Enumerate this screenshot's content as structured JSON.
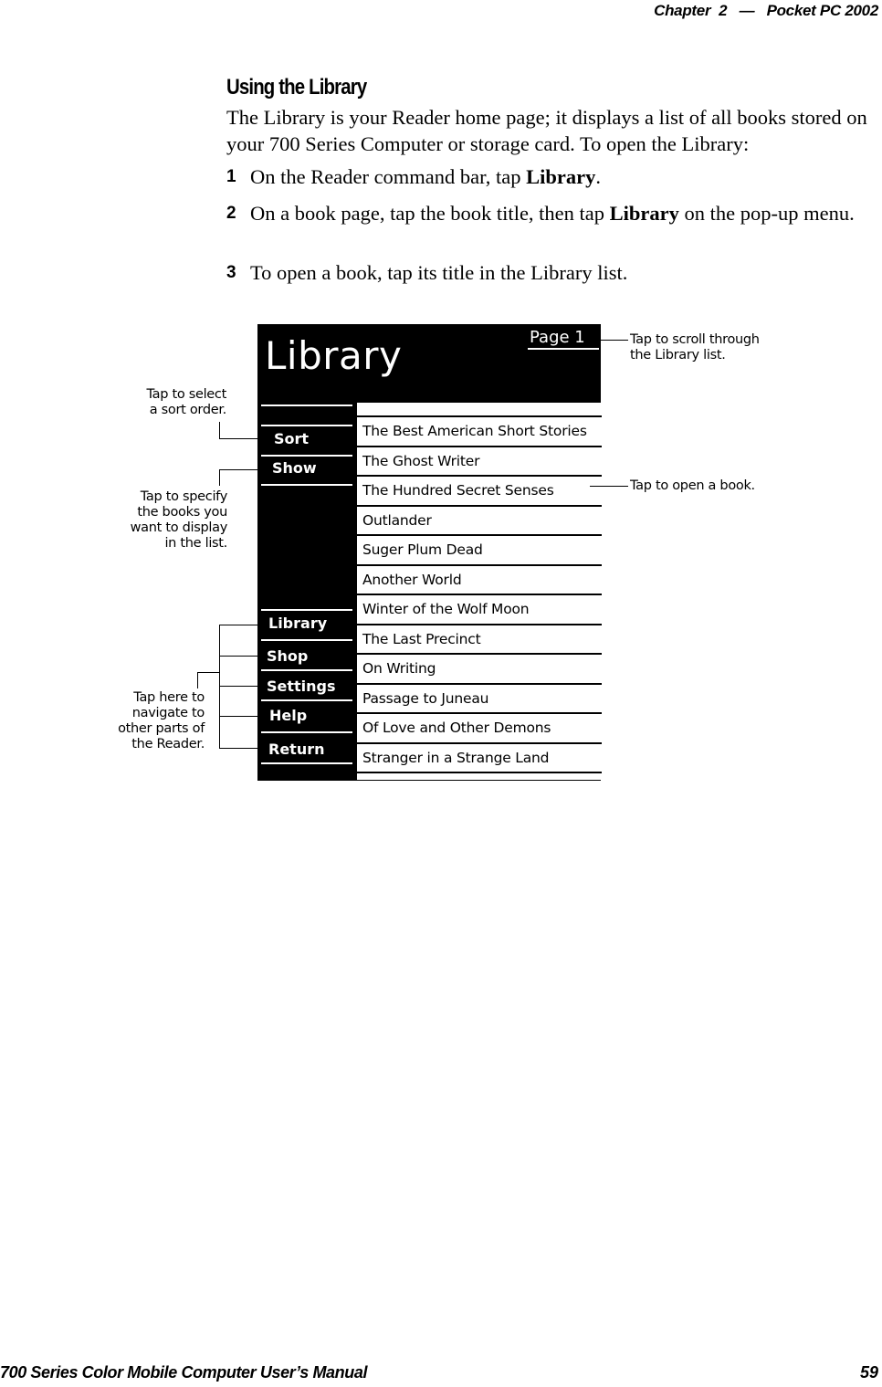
{
  "header": {
    "chapter": "Chapter  2",
    "dash": "—",
    "title": "Pocket PC 2002"
  },
  "section": {
    "title": "Using the Library",
    "intro": "The Library is your Reader home page; it displays a list of all books stored on your 700 Series Computer or storage card. To open the Library:",
    "steps": [
      {
        "num": "1",
        "pre": "On the Reader command bar, tap ",
        "bold": "Library",
        "post": "."
      },
      {
        "num": "2",
        "pre": "On a book page, tap the book title, then tap ",
        "bold": "Library",
        "post": " on the pop-up menu."
      },
      {
        "num": "3",
        "pre": "To open a book, tap its title in the Library list.",
        "bold": "",
        "post": ""
      }
    ]
  },
  "screen": {
    "title": "Library",
    "page_link": "Page 1",
    "top_menu": [
      "Sort",
      "Show"
    ],
    "nav_menu": [
      "Library",
      "Shop",
      "Settings",
      "Help",
      "Return"
    ],
    "books": [
      "The Best American Short Stories",
      "The Ghost Writer",
      "The Hundred Secret Senses",
      "Outlander",
      "Suger Plum Dead",
      "Another World",
      "Winter of the Wolf Moon",
      "The Last Precinct",
      "On Writing",
      "Passage to Juneau",
      "Of Love and Other Demons",
      "Stranger in a Strange Land"
    ]
  },
  "annotations": {
    "sort": [
      "Tap to select",
      "a sort order."
    ],
    "show": [
      "Tap to specify",
      "the books you",
      "want to display",
      "in the list."
    ],
    "nav": [
      "Tap here to",
      "navigate to",
      "other parts of",
      "the Reader."
    ],
    "scroll": [
      "Tap to scroll through",
      "the Library list."
    ],
    "open": [
      "Tap to open a book."
    ]
  },
  "footer": {
    "manual": "700 Series Color Mobile Computer User’s Manual",
    "page": "59"
  }
}
